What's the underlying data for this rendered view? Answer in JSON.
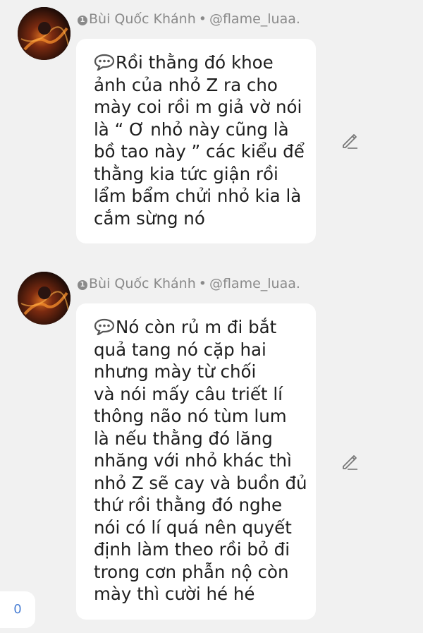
{
  "posts": [
    {
      "author": {
        "rank": "1",
        "name": "Bùi Quốc Khánh",
        "handle": "@flame_luaa."
      },
      "lines": [
        "Rồi thằng đó khoe",
        "ảnh của nhỏ Z ra cho",
        "mày coi rồi m giả vờ nói",
        "là “ Ơ nhỏ này cũng là",
        "bồ tao này ” các kiểu để",
        "thằng kia tức giận rồi",
        "lẩm bẩm chửi nhỏ kia là",
        "cắm sừng nó"
      ]
    },
    {
      "author": {
        "rank": "1",
        "name": "Bùi Quốc Khánh",
        "handle": "@flame_luaa."
      },
      "lines": [
        "Nó còn rủ m đi bắt",
        "quả tang nó cặp hai",
        "nhưng mày từ chối",
        "và nói mấy câu triết lí",
        "thông não nó tùm lum",
        "là nếu thằng đó lăng",
        "nhăng với nhỏ khác thì",
        "nhỏ Z sẽ cay và buồn đủ",
        "thứ rồi thằng đó nghe",
        "nói có lí quá nên quyết",
        "định làm theo rồi bỏ đi",
        "trong cơn phẫn nộ còn",
        "mày thì cười hé hé"
      ]
    }
  ],
  "separator": "•",
  "icons": {
    "chat": "speech-bubble-icon",
    "edit": "pencil-icon"
  },
  "counter": "0",
  "colors": {
    "background": "#f1f1f1",
    "bubble": "#ffffff",
    "meta_text": "#8a8a8a",
    "counter_text": "#4a7fd4"
  }
}
